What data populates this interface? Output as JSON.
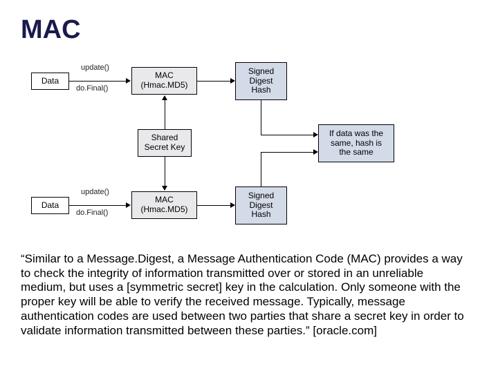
{
  "title": "MAC",
  "diagram": {
    "data_top": "Data",
    "data_bottom": "Data",
    "mac_top": "MAC\n(Hmac.MD5)",
    "mac_bottom": "MAC\n(Hmac.MD5)",
    "signed_top": "Signed\nDigest\nHash",
    "signed_bottom": "Signed\nDigest\nHash",
    "shared_key": "Shared\nSecret Key",
    "result": "If data was the\nsame, hash is\nthe same",
    "update_top": "update()",
    "dofinal_top": "do.Final()",
    "update_bottom": "update()",
    "dofinal_bottom": "do.Final()"
  },
  "description": "“Similar to a Message.Digest, a Message Authentication Code (MAC) provides a way to check the integrity of information transmitted over or stored in an unreliable medium, but uses a [symmetric secret] key in the calculation. Only someone with the proper key will be able to verify the received message. Typically, message authentication codes are used between two parties that share a secret key in order to validate information transmitted between these parties.”  [oracle.com]"
}
